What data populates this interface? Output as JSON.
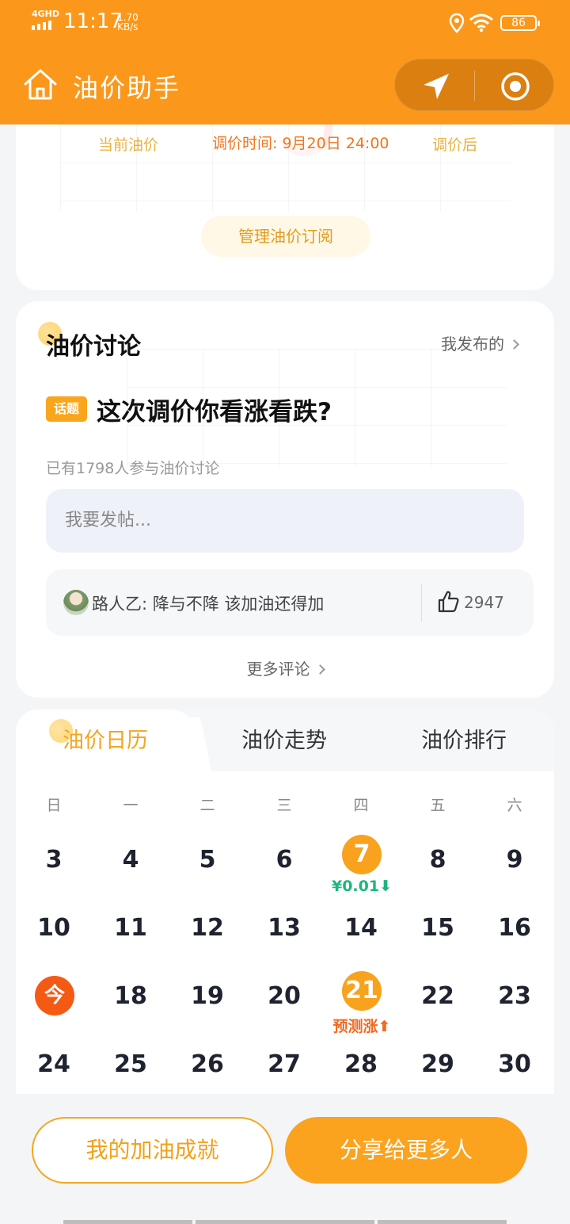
{
  "status_bar": {
    "network": "4GHD",
    "time": "11:17",
    "speed_value": "1.70",
    "speed_unit": "KB/s",
    "battery": "86"
  },
  "header": {
    "title": "油价助手"
  },
  "price_card": {
    "current_label": "当前油价",
    "adjust_time": "调价时间: 9月20日 24:00",
    "after_label": "调价后",
    "manage_button": "管理油价订阅"
  },
  "discussion": {
    "title": "油价讨论",
    "my_posts": "我发布的",
    "topic_tag": "话题",
    "topic_question": "这次调价你看涨看跌?",
    "participants": "已有1798人参与油价讨论",
    "post_placeholder": "我要发帖...",
    "top_comment": {
      "text": "路人乙: 降与不降 该加油还得加",
      "likes": "2947"
    },
    "more_comments": "更多评论"
  },
  "calendar": {
    "tabs": [
      "油价日历",
      "油价走势",
      "油价排行"
    ],
    "weekdays": [
      "日",
      "一",
      "二",
      "三",
      "四",
      "五",
      "六"
    ],
    "weeks": [
      [
        "3",
        "4",
        "5",
        "6",
        "7",
        "8",
        "9"
      ],
      [
        "10",
        "11",
        "12",
        "13",
        "14",
        "15",
        "16"
      ],
      [
        "今",
        "18",
        "19",
        "20",
        "21",
        "22",
        "23"
      ],
      [
        "24",
        "25",
        "26",
        "27",
        "28",
        "29",
        "30"
      ]
    ],
    "notes": {
      "day7": "¥0.01",
      "day21": "预测涨"
    },
    "colors": {
      "adjust_day": "#f8a21e",
      "today": "#f55a14",
      "down": "#1db77c",
      "up": "#f06a22"
    }
  },
  "bottom": {
    "achievements_button": "我的加油成就",
    "share_button": "分享给更多人"
  }
}
